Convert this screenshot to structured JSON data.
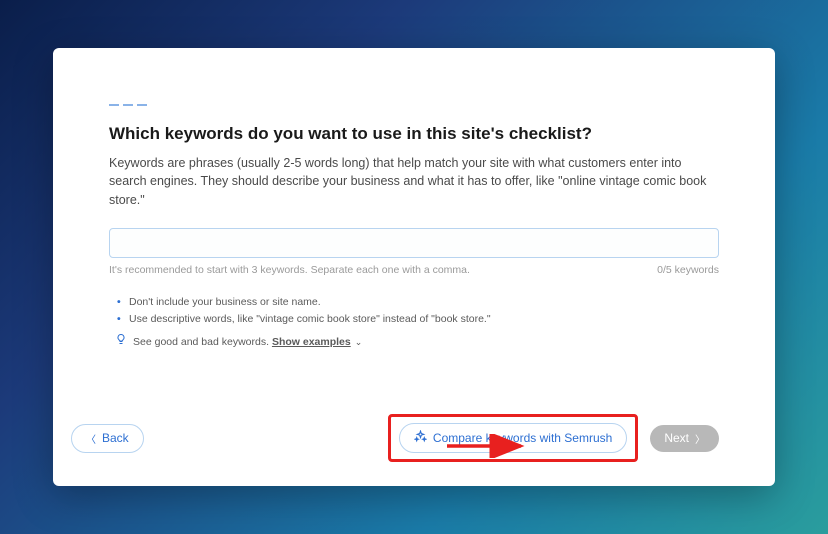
{
  "title": "Which keywords do you want to use in this site's checklist?",
  "description": "Keywords are phrases (usually 2-5 words long) that help match your site with what customers enter into search engines. They should describe your business and what it has to offer, like \"online vintage comic book store.\"",
  "input": {
    "placeholder": "",
    "hint_left": "It's recommended to start with 3 keywords. Separate each one with a comma.",
    "hint_right": "0/5 keywords"
  },
  "tips": {
    "t1": "Don't include your business or site name.",
    "t2": "Use descriptive words, like \"vintage comic book store\" instead of \"book store.\"",
    "examples_prefix": "See good and bad keywords. ",
    "examples_link": "Show examples"
  },
  "footer": {
    "back": "Back",
    "compare": "Compare keywords with Semrush",
    "next": "Next"
  }
}
